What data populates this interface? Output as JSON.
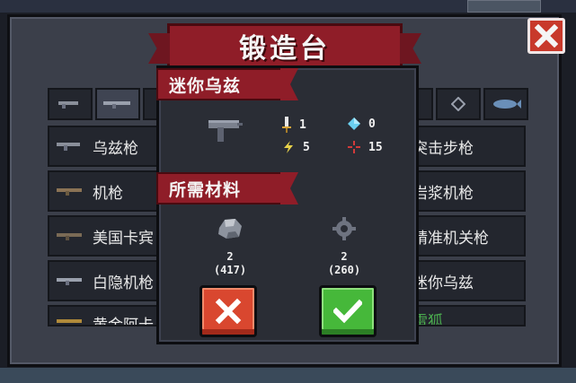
{
  "forge": {
    "title": "锻造台",
    "weapon_list": {
      "left": [
        "乌兹枪",
        "机枪",
        "美国卡宾",
        "白隐机枪",
        "黄金阿卡"
      ],
      "right": [
        "突击步枪",
        "岩浆机枪",
        "精准机关枪",
        "迷你乌兹",
        "雷狐"
      ]
    }
  },
  "popup": {
    "weapon_name": "迷你乌兹",
    "stats": {
      "damage": "1",
      "energy": "0",
      "crit": "5",
      "spread": "15"
    },
    "materials_title": "所需材料",
    "materials": [
      {
        "icon": "stone-ore-icon",
        "qty": "2",
        "owned": "(417)"
      },
      {
        "icon": "gear-part-icon",
        "qty": "2",
        "owned": "(260)"
      }
    ]
  },
  "colors": {
    "banner": "#8f1d28",
    "cancel": "#d9472f",
    "confirm": "#46b83a",
    "panel": "#3b3f4a"
  }
}
